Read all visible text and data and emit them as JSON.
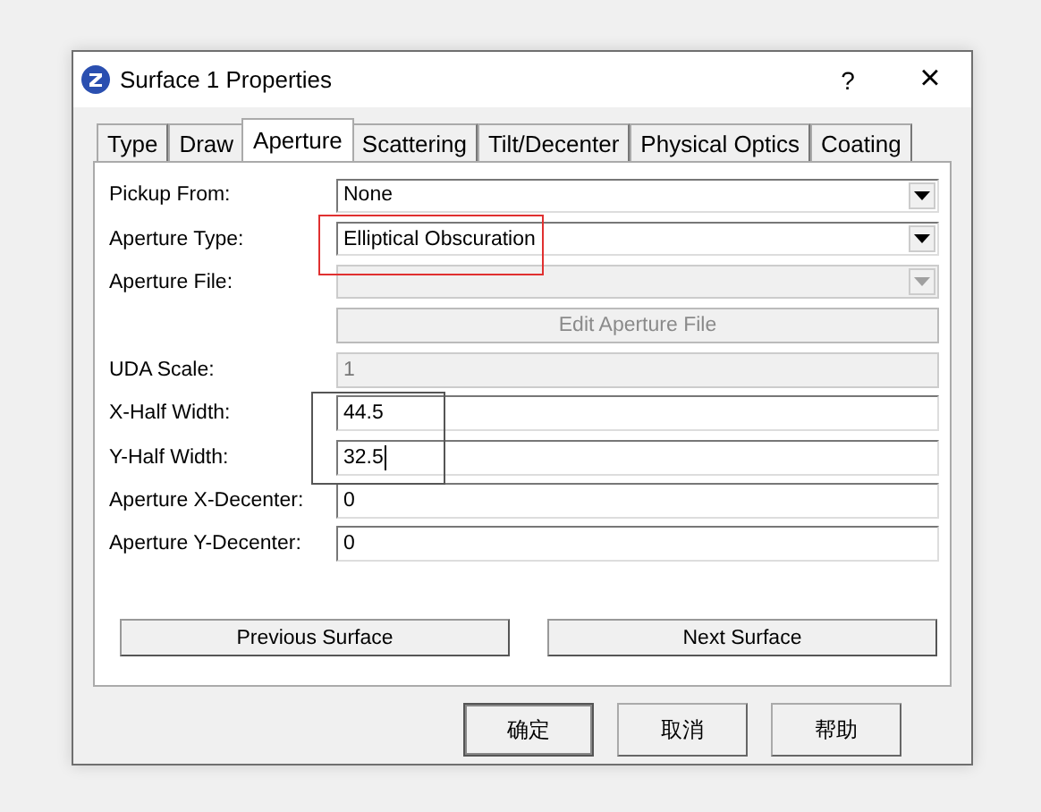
{
  "window": {
    "title": "Surface 1 Properties",
    "help": "?",
    "close": "×"
  },
  "tabs": [
    {
      "label": "Type",
      "selected": false
    },
    {
      "label": "Draw",
      "selected": false
    },
    {
      "label": "Aperture",
      "selected": true
    },
    {
      "label": "Scattering",
      "selected": false
    },
    {
      "label": "Tilt/Decenter",
      "selected": false
    },
    {
      "label": "Physical Optics",
      "selected": false
    },
    {
      "label": "Coating",
      "selected": false
    }
  ],
  "rows": [
    {
      "kind": "dropdown",
      "label": "Pickup From:",
      "value": "None",
      "disabled": false
    },
    {
      "kind": "dropdown",
      "label": "Aperture Type:",
      "value": "Elliptical Obscuration",
      "disabled": false
    },
    {
      "kind": "dropdown",
      "label": "Aperture File:",
      "disabled": true
    },
    {
      "kind": "button",
      "text": "Edit Aperture File",
      "disabled": true
    },
    {
      "kind": "text",
      "label": "UDA Scale:",
      "value": "1",
      "disabled": true,
      "focused": false
    },
    {
      "kind": "text",
      "label": "X-Half Width:",
      "value": "44.5",
      "disabled": false,
      "focused": false
    },
    {
      "kind": "text",
      "label": "Y-Half Width:",
      "value": "32.5",
      "disabled": false,
      "focused": true
    },
    {
      "kind": "text",
      "label": "Aperture X-Decenter:",
      "value": "0",
      "disabled": false,
      "focused": false
    },
    {
      "kind": "text",
      "label": "Aperture Y-Decenter:",
      "value": "0",
      "disabled": false,
      "focused": false
    }
  ],
  "nav_buttons": [
    "Previous Surface",
    "Next Surface"
  ],
  "buttons": [
    {
      "label": "确定",
      "default": true
    },
    {
      "label": "取消",
      "default": false
    },
    {
      "label": "帮助",
      "default": false
    }
  ]
}
